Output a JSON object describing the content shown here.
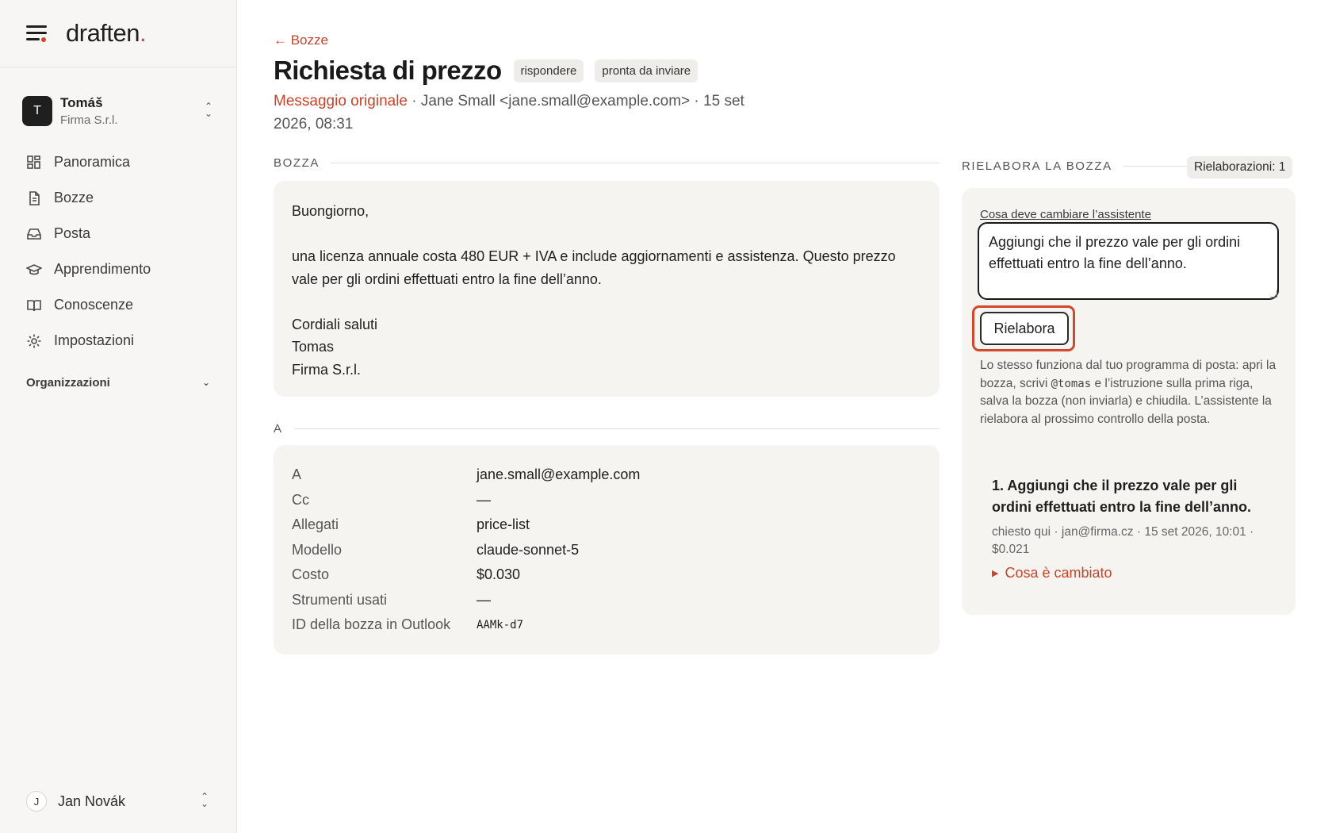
{
  "app": {
    "logo": "draften",
    "logo_dot": "."
  },
  "account": {
    "initial": "T",
    "name": "Tomáš",
    "org": "Firma S.r.l."
  },
  "nav": [
    {
      "id": "overview",
      "label": "Panoramica",
      "icon": "grid-icon"
    },
    {
      "id": "drafts",
      "label": "Bozze",
      "icon": "document-icon"
    },
    {
      "id": "mail",
      "label": "Posta",
      "icon": "inbox-icon"
    },
    {
      "id": "learning",
      "label": "Apprendimento",
      "icon": "graduation-cap-icon"
    },
    {
      "id": "knowledge",
      "label": "Conoscenze",
      "icon": "book-icon"
    },
    {
      "id": "settings",
      "label": "Impostazioni",
      "icon": "gear-icon"
    }
  ],
  "organizations_label": "Organizzazioni",
  "user": {
    "initial": "J",
    "name": "Jan Novák"
  },
  "page": {
    "back_label": "← Bozze",
    "title": "Richiesta di prezzo",
    "chips": [
      "rispondere",
      "pronta da inviare"
    ],
    "original_link": "Messaggio originale",
    "meta_rest": " · Jane Small <jane.small@example.com> · 15 set 2026, 08:31"
  },
  "draft": {
    "section_label": "BOZZA",
    "paragraphs": [
      [
        "Buongiorno,"
      ],
      [
        "una licenza annuale costa 480 EUR + IVA e include aggiornamenti e assistenza. Questo prezzo vale per gli ordini effettuati entro la fine dell’anno."
      ],
      [
        "Cordiali saluti",
        "Tomas",
        "Firma S.r.l."
      ]
    ]
  },
  "details": {
    "section_label": "A",
    "rows": [
      {
        "key": "A",
        "value": "jane.small@example.com",
        "mono": false
      },
      {
        "key": "Cc",
        "value": "—",
        "mono": false
      },
      {
        "key": "Allegati",
        "value": "price-list",
        "mono": false
      },
      {
        "key": "Modello",
        "value": "claude-sonnet-5",
        "mono": false
      },
      {
        "key": "Costo",
        "value": "$0.030",
        "mono": false
      },
      {
        "key": "Strumenti usati",
        "value": "—",
        "mono": false
      },
      {
        "key": "ID della bozza in Outlook",
        "value": "AAMk-d7",
        "mono": true
      }
    ]
  },
  "rework": {
    "section_label": "RIELABORA LA BOZZA",
    "count_label": "Rielaborazioni: 1",
    "field_label": "Cosa deve cambiare l’assistente",
    "input_value": "Aggiungi che il prezzo vale per gli ordini effettuati entro la fine dell’anno.",
    "button_label": "Rielabora",
    "help_before": "Lo stesso funziona dal tuo programma di posta: apri la bozza, scrivi ",
    "help_code": "@tomas",
    "help_after": " e l’istruzione sulla prima riga, salva la bozza (non inviarla) e chiudila. L’assistente la rielabora al prossimo controllo della posta.",
    "history": [
      {
        "title": "1. Aggiungi che il prezzo vale per gli ordini effettuati entro la fine dell’anno.",
        "meta": "chiesto qui · jan@firma.cz · 15 set 2026, 10:01 · $0.021",
        "toggle": "Cosa è cambiato"
      }
    ]
  },
  "colors": {
    "accent": "#c8432b",
    "sidebar_bg": "#f7f6f4",
    "card_bg": "#f5f4f1",
    "highlight": "#d4472f"
  }
}
